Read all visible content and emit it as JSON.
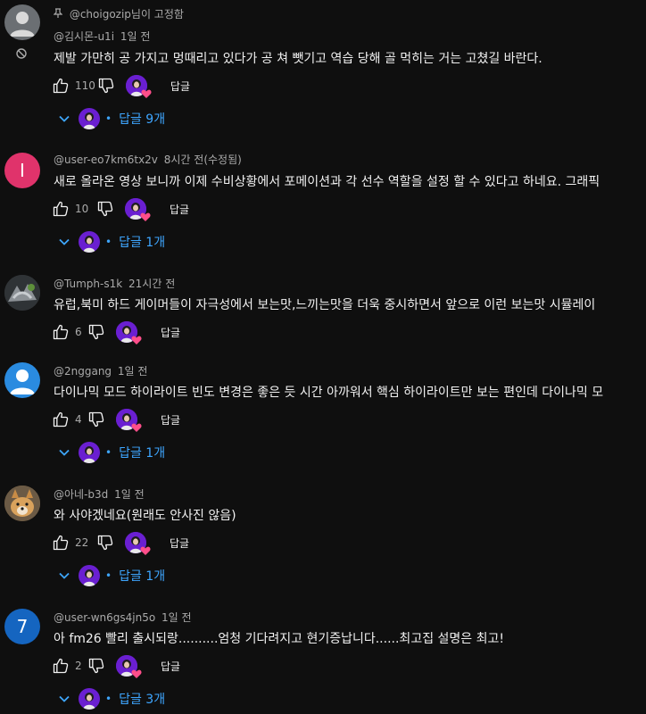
{
  "comments": [
    {
      "pinned": "@choigozip님이 고정함",
      "author": "@김시몬-u1i",
      "time": "1일 전",
      "text": "제발 가만히 공 가지고 멍때리고 있다가 공 쳐 뺏기고 역습 당해 골 먹히는 거는 고쳤길 바란다.",
      "likes": "110",
      "reply_label": "답글",
      "replies": "답글 9개",
      "avatar_color": "#6b6f73",
      "avatar_letter": ""
    },
    {
      "author": "@user-eo7km6tx2v",
      "time": "8시간 전(수정됨)",
      "text": "새로 올라온 영상 보니까 이제 수비상황에서 포메이션과 각 선수 역할을 설정 할 수 있다고 하네요. 그래픽",
      "likes": "10",
      "reply_label": "답글",
      "replies": "답글 1개",
      "avatar_color": "#e0336b",
      "avatar_letter": "I"
    },
    {
      "author": "@Tumph-s1k",
      "time": "21시간 전",
      "text": "유럽,북미 하드 게이머들이 자극성에서 보는맛,느끼는맛을 더욱 중시하면서 앞으로 이런 보는맛 시뮬레이",
      "likes": "6",
      "reply_label": "답글",
      "replies": "",
      "avatar_color": "#3a3d40",
      "avatar_letter": ""
    },
    {
      "author": "@2nggang",
      "time": "1일 전",
      "text": "다이나믹 모드 하이라이트 빈도 변경은 좋은 듯 시간 아까워서 핵심 하이라이트만 보는 편인데 다이나믹 모",
      "likes": "4",
      "reply_label": "답글",
      "replies": "답글 1개",
      "avatar_color": "#2a8be0",
      "avatar_letter": ""
    },
    {
      "author": "@아네-b3d",
      "time": "1일 전",
      "text": "와 사야겠네요(원래도 안사진 않음)",
      "likes": "22",
      "reply_label": "답글",
      "replies": "답글 1개",
      "avatar_color": "#8a6a3c",
      "avatar_letter": ""
    },
    {
      "author": "@user-wn6gs4jn5o",
      "time": "1일 전",
      "text": "아 fm26 빨리 출시되랑..........엄청 기다려지고 현기증납니다......최고집 설명은 최고!",
      "likes": "2",
      "reply_label": "답글",
      "replies": "답글 3개",
      "avatar_color": "#1565c0",
      "avatar_letter": "7"
    }
  ],
  "icons": {
    "like": "thumb-up-icon",
    "dislike": "thumb-down-icon",
    "expand": "chevron-down-icon",
    "heart": "creator-heart-icon",
    "pin": "pin-icon",
    "blocked": "blocked-icon"
  },
  "colors": {
    "background": "#0f0f0f",
    "text": "#f1f1f1",
    "meta": "#aaaaaa",
    "link": "#3ea6ff",
    "heart": "#ff4e8a"
  }
}
